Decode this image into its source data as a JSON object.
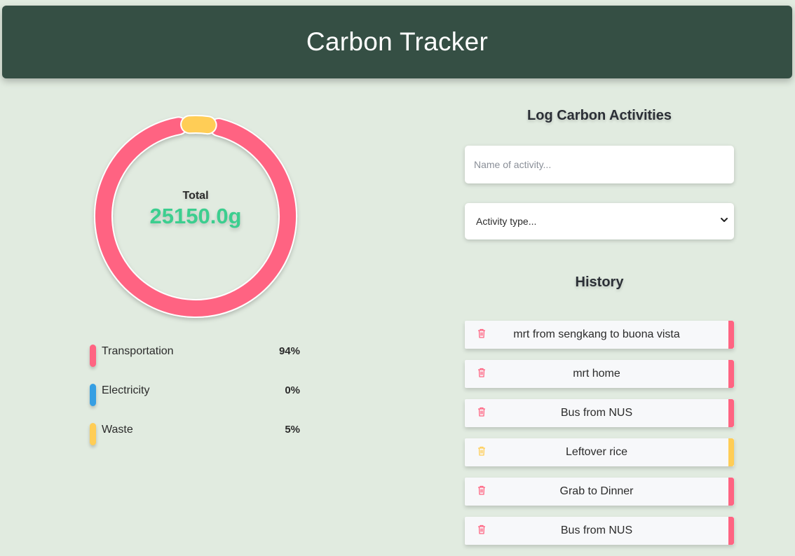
{
  "header": {
    "title": "Carbon Tracker"
  },
  "summary": {
    "total_label": "Total",
    "total_value": "25150.0g"
  },
  "chart_data": {
    "type": "pie",
    "categories": [
      "Transportation",
      "Electricity",
      "Waste"
    ],
    "values": [
      94,
      0,
      5
    ],
    "colors": [
      "#ff6482",
      "#369fe3",
      "#ffcd56"
    ]
  },
  "legend": [
    {
      "name": "Transportation",
      "percent": "94%",
      "color": "#ff6482"
    },
    {
      "name": "Electricity",
      "percent": "0%",
      "color": "#369fe3"
    },
    {
      "name": "Waste",
      "percent": "5%",
      "color": "#ffcd56"
    }
  ],
  "form": {
    "title": "Log Carbon Activities",
    "activity_name_placeholder": "Name of activity...",
    "activity_type_selected": "Activity type..."
  },
  "history": {
    "title": "History",
    "items": [
      {
        "label": "mrt from sengkang to buona vista",
        "category": "Transportation",
        "color": "#ff6482",
        "icon": "trash-icon"
      },
      {
        "label": "mrt home",
        "category": "Transportation",
        "color": "#ff6482",
        "icon": "trash-icon"
      },
      {
        "label": "Bus from NUS",
        "category": "Transportation",
        "color": "#ff6482",
        "icon": "trash-icon"
      },
      {
        "label": "Leftover rice",
        "category": "Waste",
        "color": "#ffcd56",
        "icon": "trash-icon"
      },
      {
        "label": "Grab to Dinner",
        "category": "Transportation",
        "color": "#ff6482",
        "icon": "trash-icon"
      },
      {
        "label": "Bus from NUS",
        "category": "Transportation",
        "color": "#ff6482",
        "icon": "trash-icon"
      }
    ]
  }
}
